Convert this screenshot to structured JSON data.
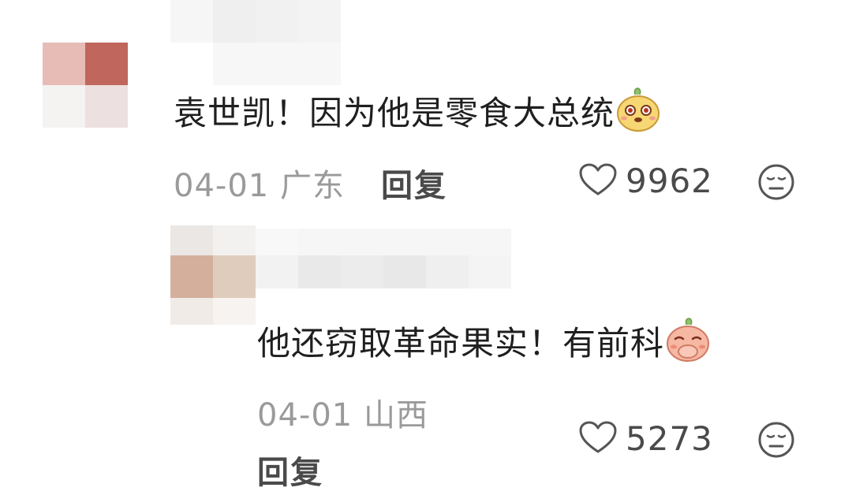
{
  "comments": [
    {
      "text": "袁世凯！因为他是零食大总统",
      "emoji": "yellow-blob-emoji",
      "date": "04-01",
      "location": "广东",
      "reply_label": "回复",
      "likes": "9962",
      "dislike_icon": "neutral-face-icon"
    },
    {
      "text": "他还窃取革命果实！有前科",
      "emoji": "pink-blob-cover-mouth-emoji",
      "date": "04-01",
      "location": "山西",
      "reply_label": "回复",
      "likes": "5273",
      "dislike_icon": "neutral-face-icon"
    }
  ],
  "colors": {
    "avatar1_top_right": "#c0665c",
    "avatar1_top_left": "#e7bcb6",
    "avatar2_left": "#d4b09c",
    "meta_gray": "#9a9a9a"
  }
}
